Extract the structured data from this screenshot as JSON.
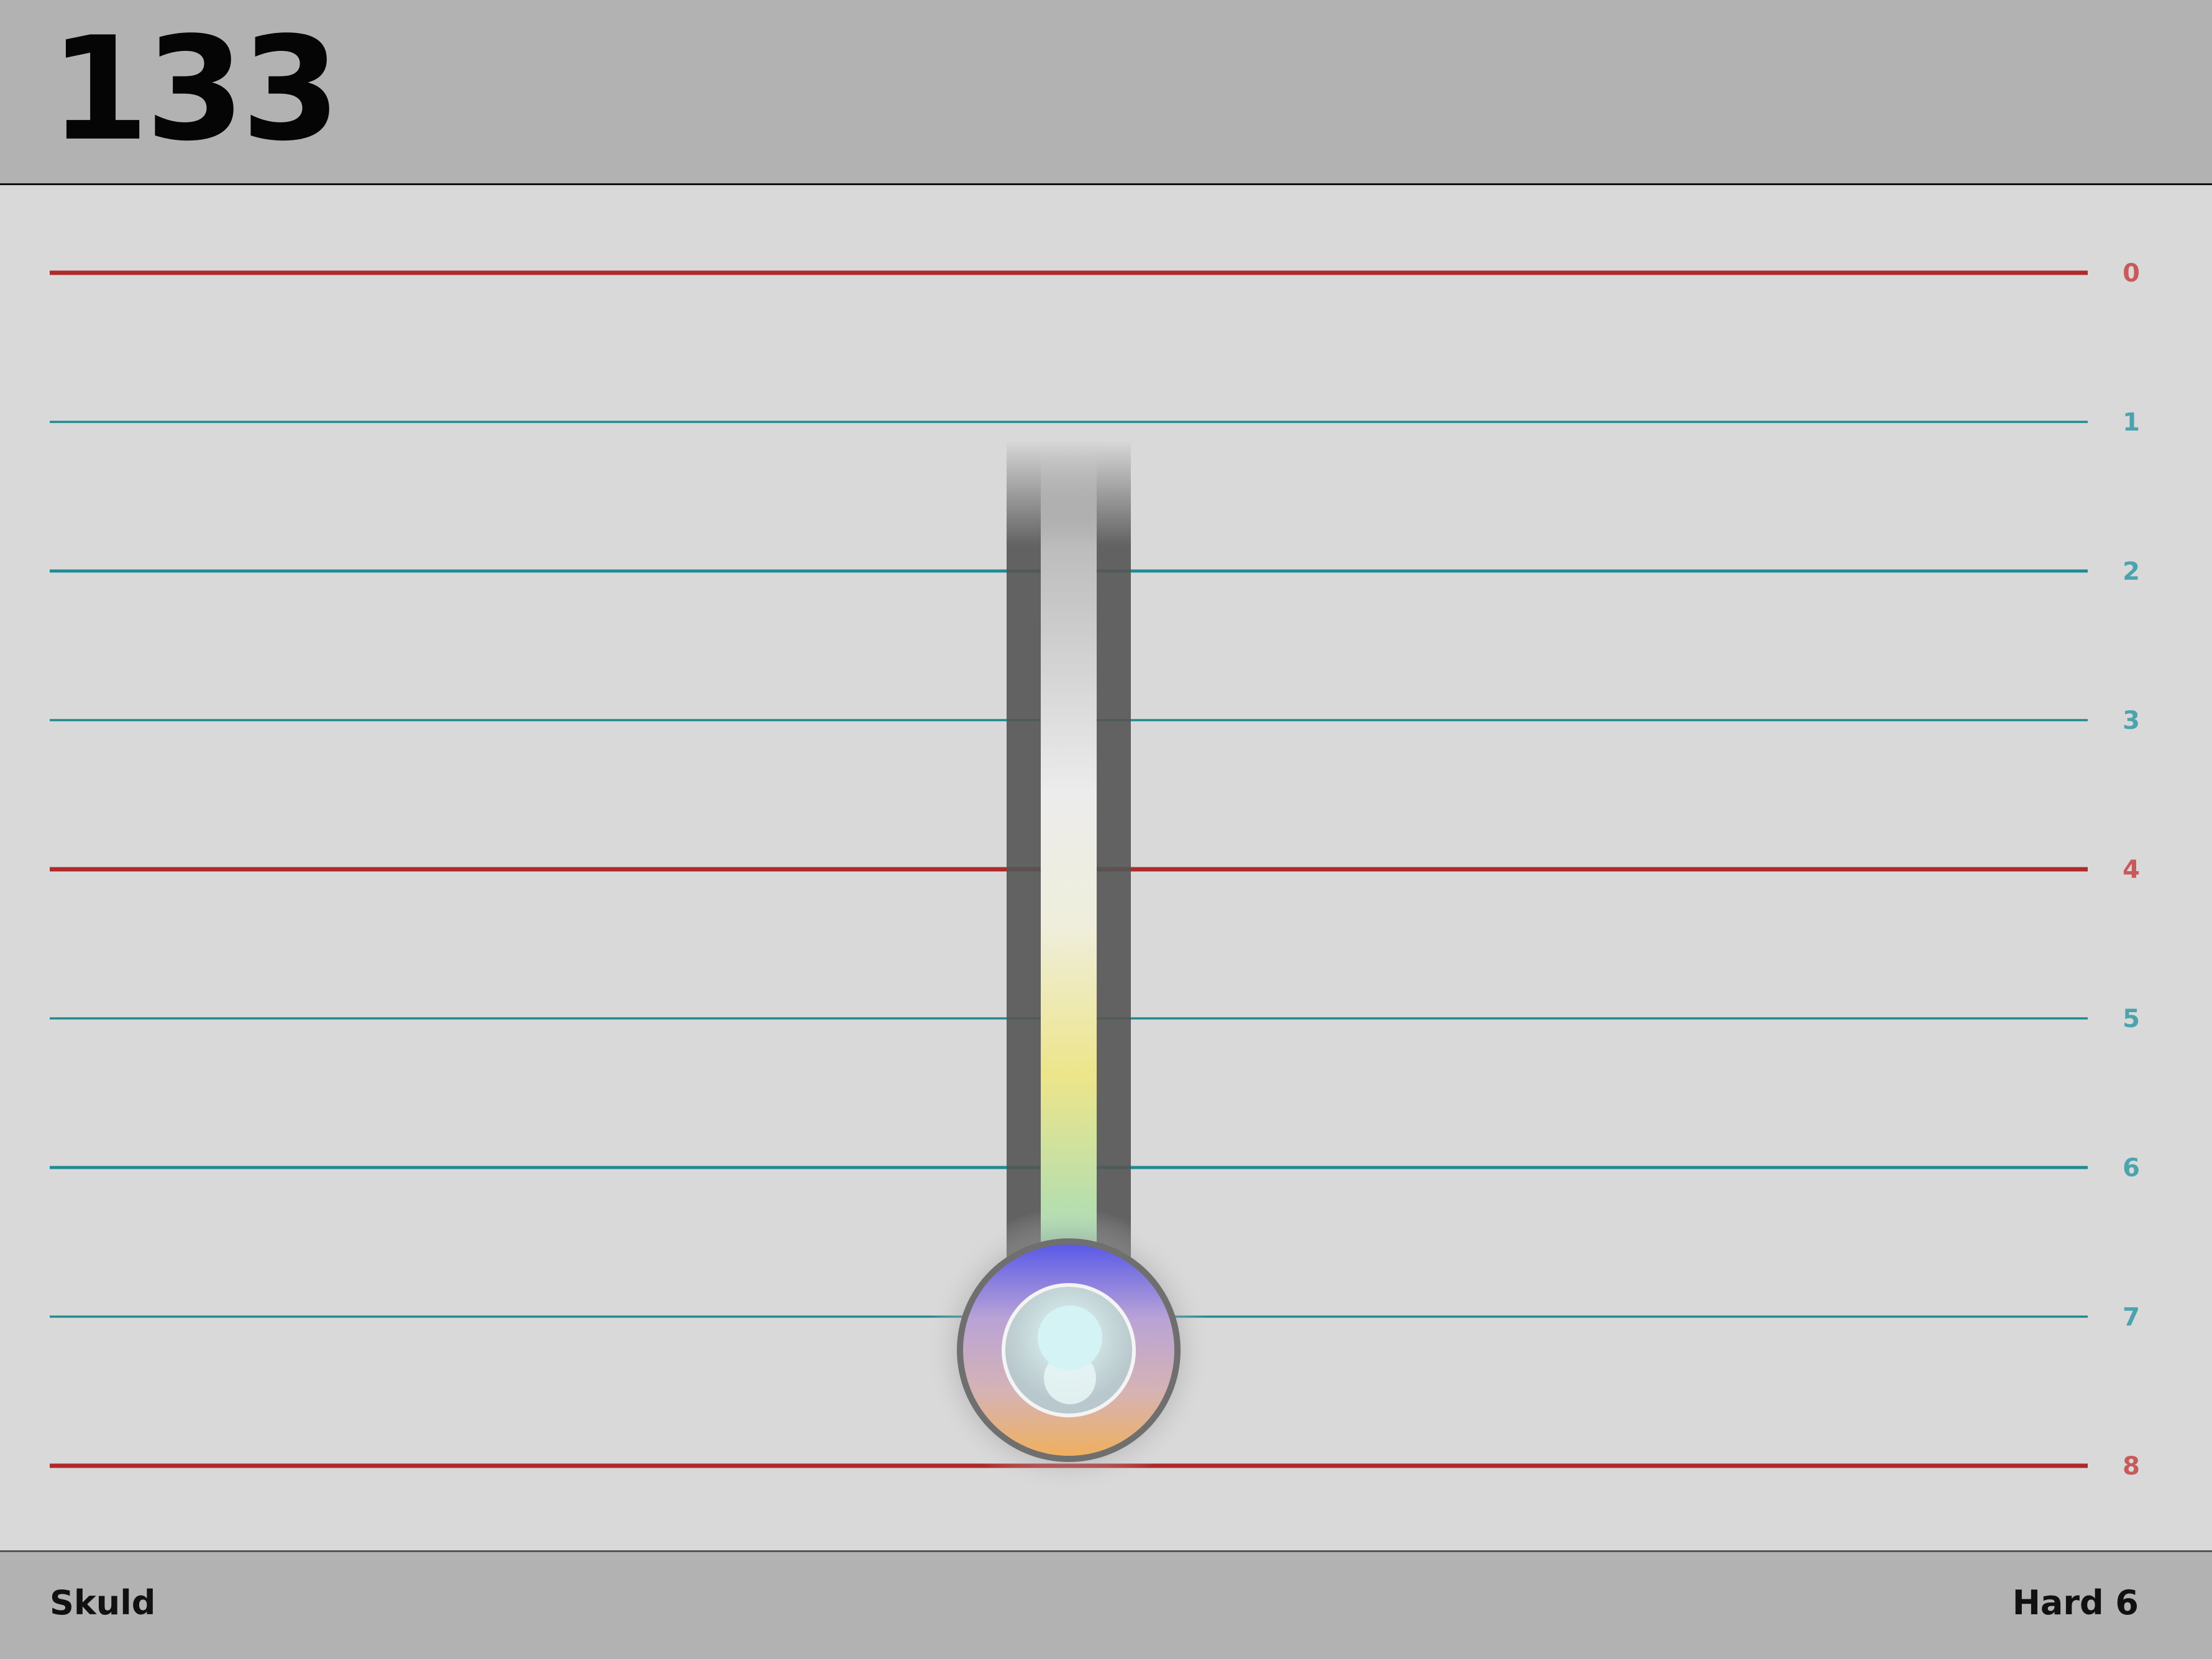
{
  "header": {
    "score": "133"
  },
  "footer": {
    "song": "Skuld",
    "difficulty": "Hard 6"
  },
  "lanes": [
    {
      "label": "0",
      "type": "major"
    },
    {
      "label": "1",
      "type": "minor"
    },
    {
      "label": "2",
      "type": "minor-bold"
    },
    {
      "label": "3",
      "type": "minor"
    },
    {
      "label": "4",
      "type": "major"
    },
    {
      "label": "5",
      "type": "minor"
    },
    {
      "label": "6",
      "type": "minor-bold"
    },
    {
      "label": "7",
      "type": "minor"
    },
    {
      "label": "8",
      "type": "major"
    }
  ],
  "colors": {
    "major_line": "#b02a2a",
    "minor_line": "#1f8a93",
    "major_label": "#c85a5a",
    "minor_label": "#4aa4ad"
  },
  "cursor": {
    "icon": "hold-note-cursor-icon"
  }
}
